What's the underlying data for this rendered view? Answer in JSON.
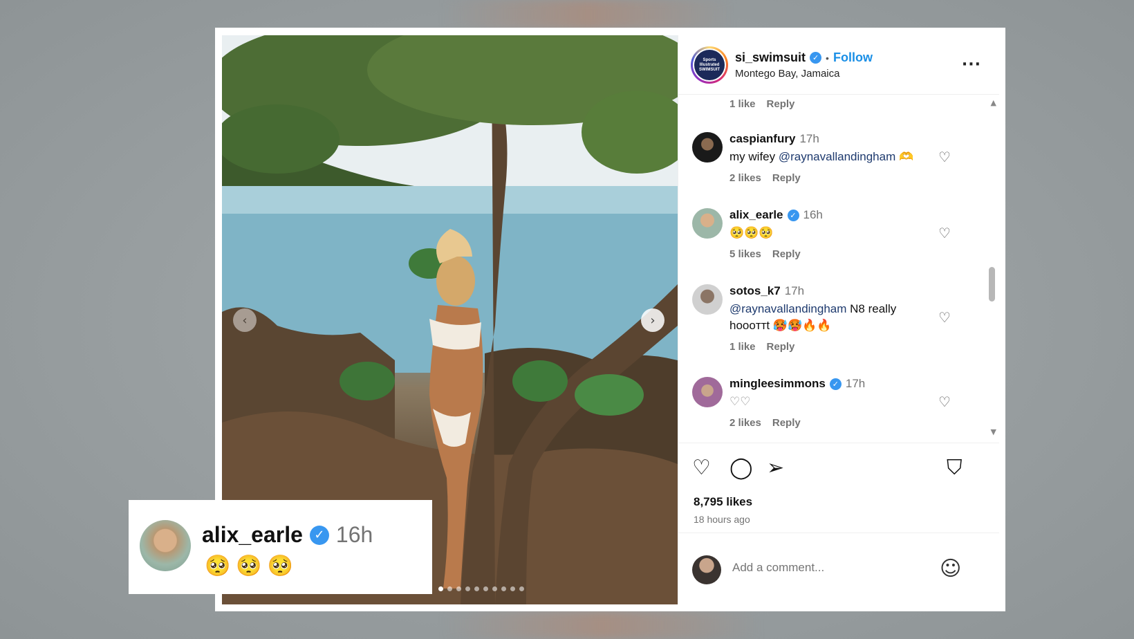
{
  "post": {
    "account": {
      "username": "si_swimsuit",
      "verified": true,
      "follow_label": "Follow",
      "location": "Montego Bay, Jamaica",
      "avatar_icon": "sports-illustrated-swimsuit-logo",
      "more_icon": "more-options-icon"
    },
    "carousel": {
      "prev_icon": "chevron-left-icon",
      "next_icon": "chevron-right-icon",
      "slide_count": 10,
      "active_slide": 1
    }
  },
  "comments": {
    "first_meta": {
      "likes": "1 like",
      "reply": "Reply"
    },
    "items": [
      {
        "username": "caspianfury",
        "verified": false,
        "time": "17h",
        "text_prefix": "my wifey ",
        "mention": "@raynavallandingham",
        "text_suffix": " 🫶",
        "likes": "2 likes",
        "reply": "Reply"
      },
      {
        "username": "alix_earle",
        "verified": true,
        "time": "16h",
        "emoji_text": "🥺🥺🥺",
        "likes": "5 likes",
        "reply": "Reply"
      },
      {
        "username": "sotos_k7",
        "verified": false,
        "time": "17h",
        "mention": "@raynavallandingham",
        "text_suffix": " N8 really",
        "text_line2": "hoooттt 🥵🥵🔥🔥",
        "likes": "1 like",
        "reply": "Reply"
      },
      {
        "username": "mingleesimmons",
        "verified": true,
        "time": "17h",
        "emoji_text": "♡♡",
        "likes": "2 likes",
        "reply": "Reply"
      }
    ]
  },
  "actions": {
    "like_icon": "heart-icon",
    "comment_icon": "comment-bubble-icon",
    "share_icon": "paper-plane-icon",
    "save_icon": "bookmark-icon",
    "likes_count": "8,795 likes",
    "time_ago": "18 hours ago"
  },
  "add_comment": {
    "placeholder": "Add a comment...",
    "emoji_icon": "smiley-icon"
  },
  "zoom_overlay": {
    "username": "alix_earle",
    "verified": true,
    "time": "16h",
    "emoji_text": "🥺🥺🥺"
  },
  "colors": {
    "link_blue": "#1a8fe6",
    "verified_blue": "#3897f0",
    "mention_navy": "#1e3a6e",
    "muted_gray": "#737373"
  }
}
